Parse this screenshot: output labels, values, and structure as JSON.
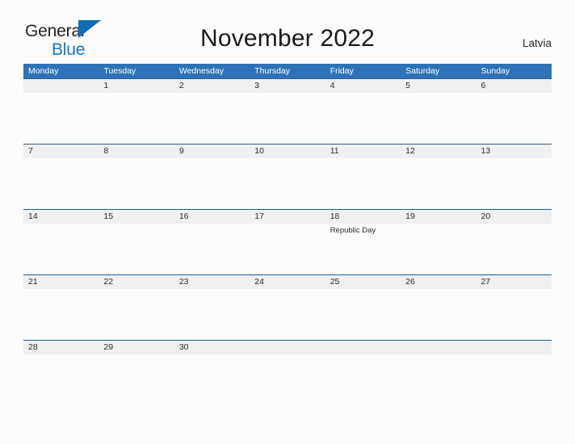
{
  "brand": {
    "name_part1": "General",
    "name_part2": "Blue",
    "flag_icon": "blue-triangle-flag-icon",
    "color_dark": "#231f20",
    "color_blue": "#1577c4"
  },
  "header": {
    "title": "November 2022",
    "country": "Latvia"
  },
  "theme": {
    "header_blue": "#2e73b8",
    "rule_blue": "#225d96",
    "band_gray": "#f0f0f0",
    "page_bg": "#fcfcfc"
  },
  "calendar": {
    "month": "November",
    "year": "2022",
    "week_start": "Monday",
    "weekdays": [
      "Monday",
      "Tuesday",
      "Wednesday",
      "Thursday",
      "Friday",
      "Saturday",
      "Sunday"
    ],
    "weeks": [
      {
        "days": [
          {
            "num": "",
            "events": []
          },
          {
            "num": "1",
            "events": []
          },
          {
            "num": "2",
            "events": []
          },
          {
            "num": "3",
            "events": []
          },
          {
            "num": "4",
            "events": []
          },
          {
            "num": "5",
            "events": []
          },
          {
            "num": "6",
            "events": []
          }
        ]
      },
      {
        "days": [
          {
            "num": "7",
            "events": []
          },
          {
            "num": "8",
            "events": []
          },
          {
            "num": "9",
            "events": []
          },
          {
            "num": "10",
            "events": []
          },
          {
            "num": "11",
            "events": []
          },
          {
            "num": "12",
            "events": []
          },
          {
            "num": "13",
            "events": []
          }
        ]
      },
      {
        "days": [
          {
            "num": "14",
            "events": []
          },
          {
            "num": "15",
            "events": []
          },
          {
            "num": "16",
            "events": []
          },
          {
            "num": "17",
            "events": []
          },
          {
            "num": "18",
            "events": [
              "Republic Day"
            ]
          },
          {
            "num": "19",
            "events": []
          },
          {
            "num": "20",
            "events": []
          }
        ]
      },
      {
        "days": [
          {
            "num": "21",
            "events": []
          },
          {
            "num": "22",
            "events": []
          },
          {
            "num": "23",
            "events": []
          },
          {
            "num": "24",
            "events": []
          },
          {
            "num": "25",
            "events": []
          },
          {
            "num": "26",
            "events": []
          },
          {
            "num": "27",
            "events": []
          }
        ]
      },
      {
        "days": [
          {
            "num": "28",
            "events": []
          },
          {
            "num": "29",
            "events": []
          },
          {
            "num": "30",
            "events": []
          },
          {
            "num": "",
            "events": []
          },
          {
            "num": "",
            "events": []
          },
          {
            "num": "",
            "events": []
          },
          {
            "num": "",
            "events": []
          }
        ]
      }
    ]
  }
}
